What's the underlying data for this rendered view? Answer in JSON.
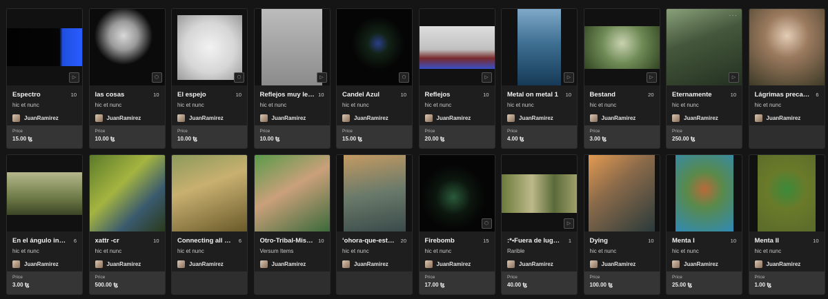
{
  "common": {
    "price_label": "Price"
  },
  "cards": [
    {
      "title": "Espectro",
      "edition": "10",
      "platform": "hic et nunc",
      "creator": "JuanRamirez",
      "price": "15.00 ꜩ",
      "badge": "▷",
      "w": 111,
      "h": 55,
      "bg": "linear-gradient(90deg,#020202 0%,#050505 70%,#1f4fe0 74%,#2a5cff 100%)"
    },
    {
      "title": "las cosas",
      "edition": "10",
      "platform": "hic et nunc",
      "creator": "JuanRamirez",
      "price": "10.00 ꜩ",
      "badge": "⬡",
      "w": 111,
      "h": 111,
      "bg": "radial-gradient(circle at 45% 35%,#d8d8d8 0%,#9a9a9a 22%,#0b0b0b 45%)"
    },
    {
      "title": "El espejo",
      "edition": "10",
      "platform": "hic et nunc",
      "creator": "JuanRamirez",
      "price": "10.00 ꜩ",
      "badge": "⬡",
      "w": 94,
      "h": 94,
      "bg": "radial-gradient(circle,#f2f2f2 0%,#d6d6d6 55%,#9a9a9a 100%)"
    },
    {
      "title": "Reflejos muy lejanos",
      "edition": "10",
      "platform": "hic et nunc",
      "creator": "JuanRamirez",
      "price": "10.00 ꜩ",
      "badge": "▷",
      "w": 88,
      "h": 111,
      "bg": "linear-gradient(180deg,#bcbcbc,#8b8b8b)"
    },
    {
      "title": "Candel Azul",
      "edition": "10",
      "platform": "hic et nunc",
      "creator": "JuanRamirez",
      "price": "15.00 ꜩ",
      "badge": "⬡",
      "w": 111,
      "h": 111,
      "bg": "radial-gradient(ellipse at 55% 45%,#2a3f88 0%,#122216 18%,#050505 45%)"
    },
    {
      "title": "Reflejos",
      "edition": "10",
      "platform": "hic et nunc",
      "creator": "JuanRamirez",
      "price": "20.00 ꜩ",
      "badge": "▷",
      "w": 111,
      "h": 62,
      "bg": "linear-gradient(180deg,#dedede 0%,#bfbfbf 55%,#7a2a2a 75%,#3850c8 100%)"
    },
    {
      "title": "Metal on metal 1",
      "edition": "10",
      "platform": "hic et nunc",
      "creator": "JuanRamirez",
      "price": "4.00 ꜩ",
      "badge": "▷",
      "w": 63,
      "h": 111,
      "bg": "linear-gradient(180deg,#7fa9c8 0%,#3e6f92 45%,#163a57 100%)"
    },
    {
      "title": "Bestand",
      "edition": "20",
      "platform": "hic et nunc",
      "creator": "JuanRamirez",
      "price": "3.00 ꜩ",
      "badge": "▷",
      "w": 111,
      "h": 62,
      "bg": "radial-gradient(circle at 50% 40%,#c8d2b0 0%,#6f8a55 45%,#314422 100%)"
    },
    {
      "title": "Eternamente",
      "edition": "10",
      "platform": "hic et nunc",
      "creator": "JuanRamirez",
      "price": "250.00 ꜩ",
      "badge": "▷",
      "more": "···",
      "w": 111,
      "h": 111,
      "bg": "linear-gradient(160deg,#8aa07a 0%,#45583c 40%,#233021 100%)"
    },
    {
      "title": "Lágrimas precarias",
      "edition": "6",
      "platform": "hic et nunc",
      "creator": "JuanRamirez",
      "price": "",
      "badge": "",
      "w": 111,
      "h": 111,
      "bg": "radial-gradient(circle at 50% 35%,#e3cdb6 0%,#9b7a5e 35%,#3d3a27 100%)"
    },
    {
      "title": "En el ángulo inferior",
      "edition": "6",
      "platform": "hic et nunc",
      "creator": "JuanRamirez",
      "price": "3.00 ꜩ",
      "badge": "",
      "w": 111,
      "h": 62,
      "bg": "linear-gradient(180deg,#b5b88c 0%,#6e7a47 60%,#3d4527 100%)"
    },
    {
      "title": "xattr -cr",
      "edition": "10",
      "platform": "hic et nunc",
      "creator": "JuanRamirez",
      "price": "500.00 ꜩ",
      "badge": "",
      "w": 111,
      "h": 111,
      "bg": "linear-gradient(135deg,#5a7a2a 0%,#a5b440 40%,#3a5a6e 70%,#2a3a1a 100%)"
    },
    {
      "title": "Connecting all the points",
      "edition": "6",
      "platform": "hic et nunc",
      "creator": "JuanRamirez",
      "price": "",
      "badge": "",
      "w": 111,
      "h": 111,
      "bg": "linear-gradient(160deg,#8c9a5a 0%,#c8b070 40%,#6a5a2a 100%)"
    },
    {
      "title": "Otro-Tribal-Mismo",
      "edition": "10",
      "platform": "Versum Items",
      "creator": "JuanRamirez",
      "price": "",
      "badge": "",
      "w": 111,
      "h": 111,
      "bg": "linear-gradient(150deg,#5a9a4a 0%,#caa07a 45%,#3a6a3a 100%)"
    },
    {
      "title": "ʻohora-que-estamos",
      "edition": "20",
      "platform": "hic et nunc",
      "creator": "JuanRamirez",
      "price": "",
      "badge": "",
      "w": 90,
      "h": 111,
      "bg": "linear-gradient(170deg,#c49a62 0%,#6a7a6a 50%,#3a4a4a 100%)"
    },
    {
      "title": "Firebomb",
      "edition": "15",
      "platform": "hic et nunc",
      "creator": "JuanRamirez",
      "price": "17.00 ꜩ",
      "badge": "⬡",
      "w": 111,
      "h": 111,
      "bg": "radial-gradient(ellipse at 45% 55%,#2a5a3a 0%,#0c160e 30%,#050505 55%)"
    },
    {
      "title": ":*•Fuera de lugar•*:",
      "edition": "1",
      "platform": "Rarible",
      "creator": "JuanRamirez",
      "price": "40.00 ꜩ",
      "badge": "▷",
      "w": 111,
      "h": 56,
      "bg": "linear-gradient(90deg,#6a7a3a 0%,#bdb88a 40%,#5a6a3a 70%,#a0a06a 100%)"
    },
    {
      "title": "Dying",
      "edition": "10",
      "platform": "hic et nunc",
      "creator": "JuanRamirez",
      "price": "100.00 ꜩ",
      "badge": "",
      "w": 96,
      "h": 111,
      "bg": "linear-gradient(140deg,#e39a52 0%,#8a6a4a 40%,#2a3a3a 100%)"
    },
    {
      "title": "Menta I",
      "edition": "10",
      "platform": "hic et nunc",
      "creator": "JuanRamirez",
      "price": "25.00 ꜩ",
      "badge": "",
      "w": 84,
      "h": 111,
      "bg": "radial-gradient(circle at 50% 45%,#b86a3a 0%,#5a8a4a 35%,#2f8ab6 100%)"
    },
    {
      "title": "Menta II",
      "edition": "10",
      "platform": "hic et nunc",
      "creator": "JuanRamirez",
      "price": "1.00 ꜩ",
      "badge": "",
      "w": 84,
      "h": 111,
      "bg": "radial-gradient(circle at 50% 45%,#3a8a3a 0%,#6a7a2a 40%,#5a6a2a 100%)"
    }
  ]
}
